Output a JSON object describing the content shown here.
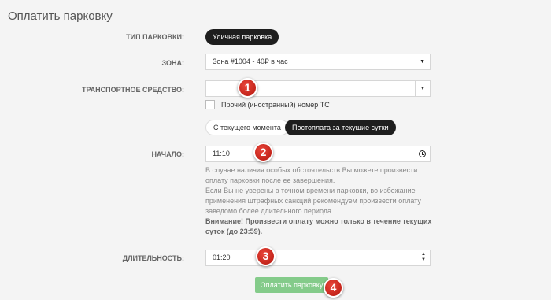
{
  "page_title": "Оплатить парковку",
  "parking_type": {
    "label": "ТИП ПАРКОВКИ:",
    "value": "Уличная парковка"
  },
  "zone": {
    "label": "ЗОНА:",
    "value": "Зона #1004 - 40₽ в час",
    "caret": "▼"
  },
  "vehicle": {
    "label": "ТРАНСПОРТНОЕ СРЕДСТВО:",
    "value": "",
    "caret": "▼",
    "checkbox_label": "Прочий (иностранный) номер ТС"
  },
  "payment_mode": {
    "options": [
      "С текущего момента",
      "Постоплата за текущие сутки"
    ],
    "selected": "Постоплата за текущие сутки"
  },
  "start": {
    "label": "НАЧАЛО:",
    "value": "11:10",
    "icon": "clock-icon"
  },
  "help_text": {
    "line1": "В случае наличия особых обстоятельств Вы можете произвести оплату парковки после ее завершения.",
    "line2": "Если Вы не уверены в точном времени парковки, во избежание применения штрафных санкций рекомендуем произвести оплату заведомо более длительного периода.",
    "warning": "Внимание! Произвести оплату можно только в течение текущих суток (до 23:59)."
  },
  "duration": {
    "label": "ДЛИТЕЛЬНОСТЬ:",
    "value": "01:20",
    "up": "▲",
    "down": "▼"
  },
  "submit_label": "Оплатить парковку",
  "markers": [
    "1",
    "2",
    "3",
    "4"
  ],
  "colors": {
    "dark_pill": "#1e1e1e",
    "submit": "#84cb8a",
    "marker": "#d0251a"
  }
}
